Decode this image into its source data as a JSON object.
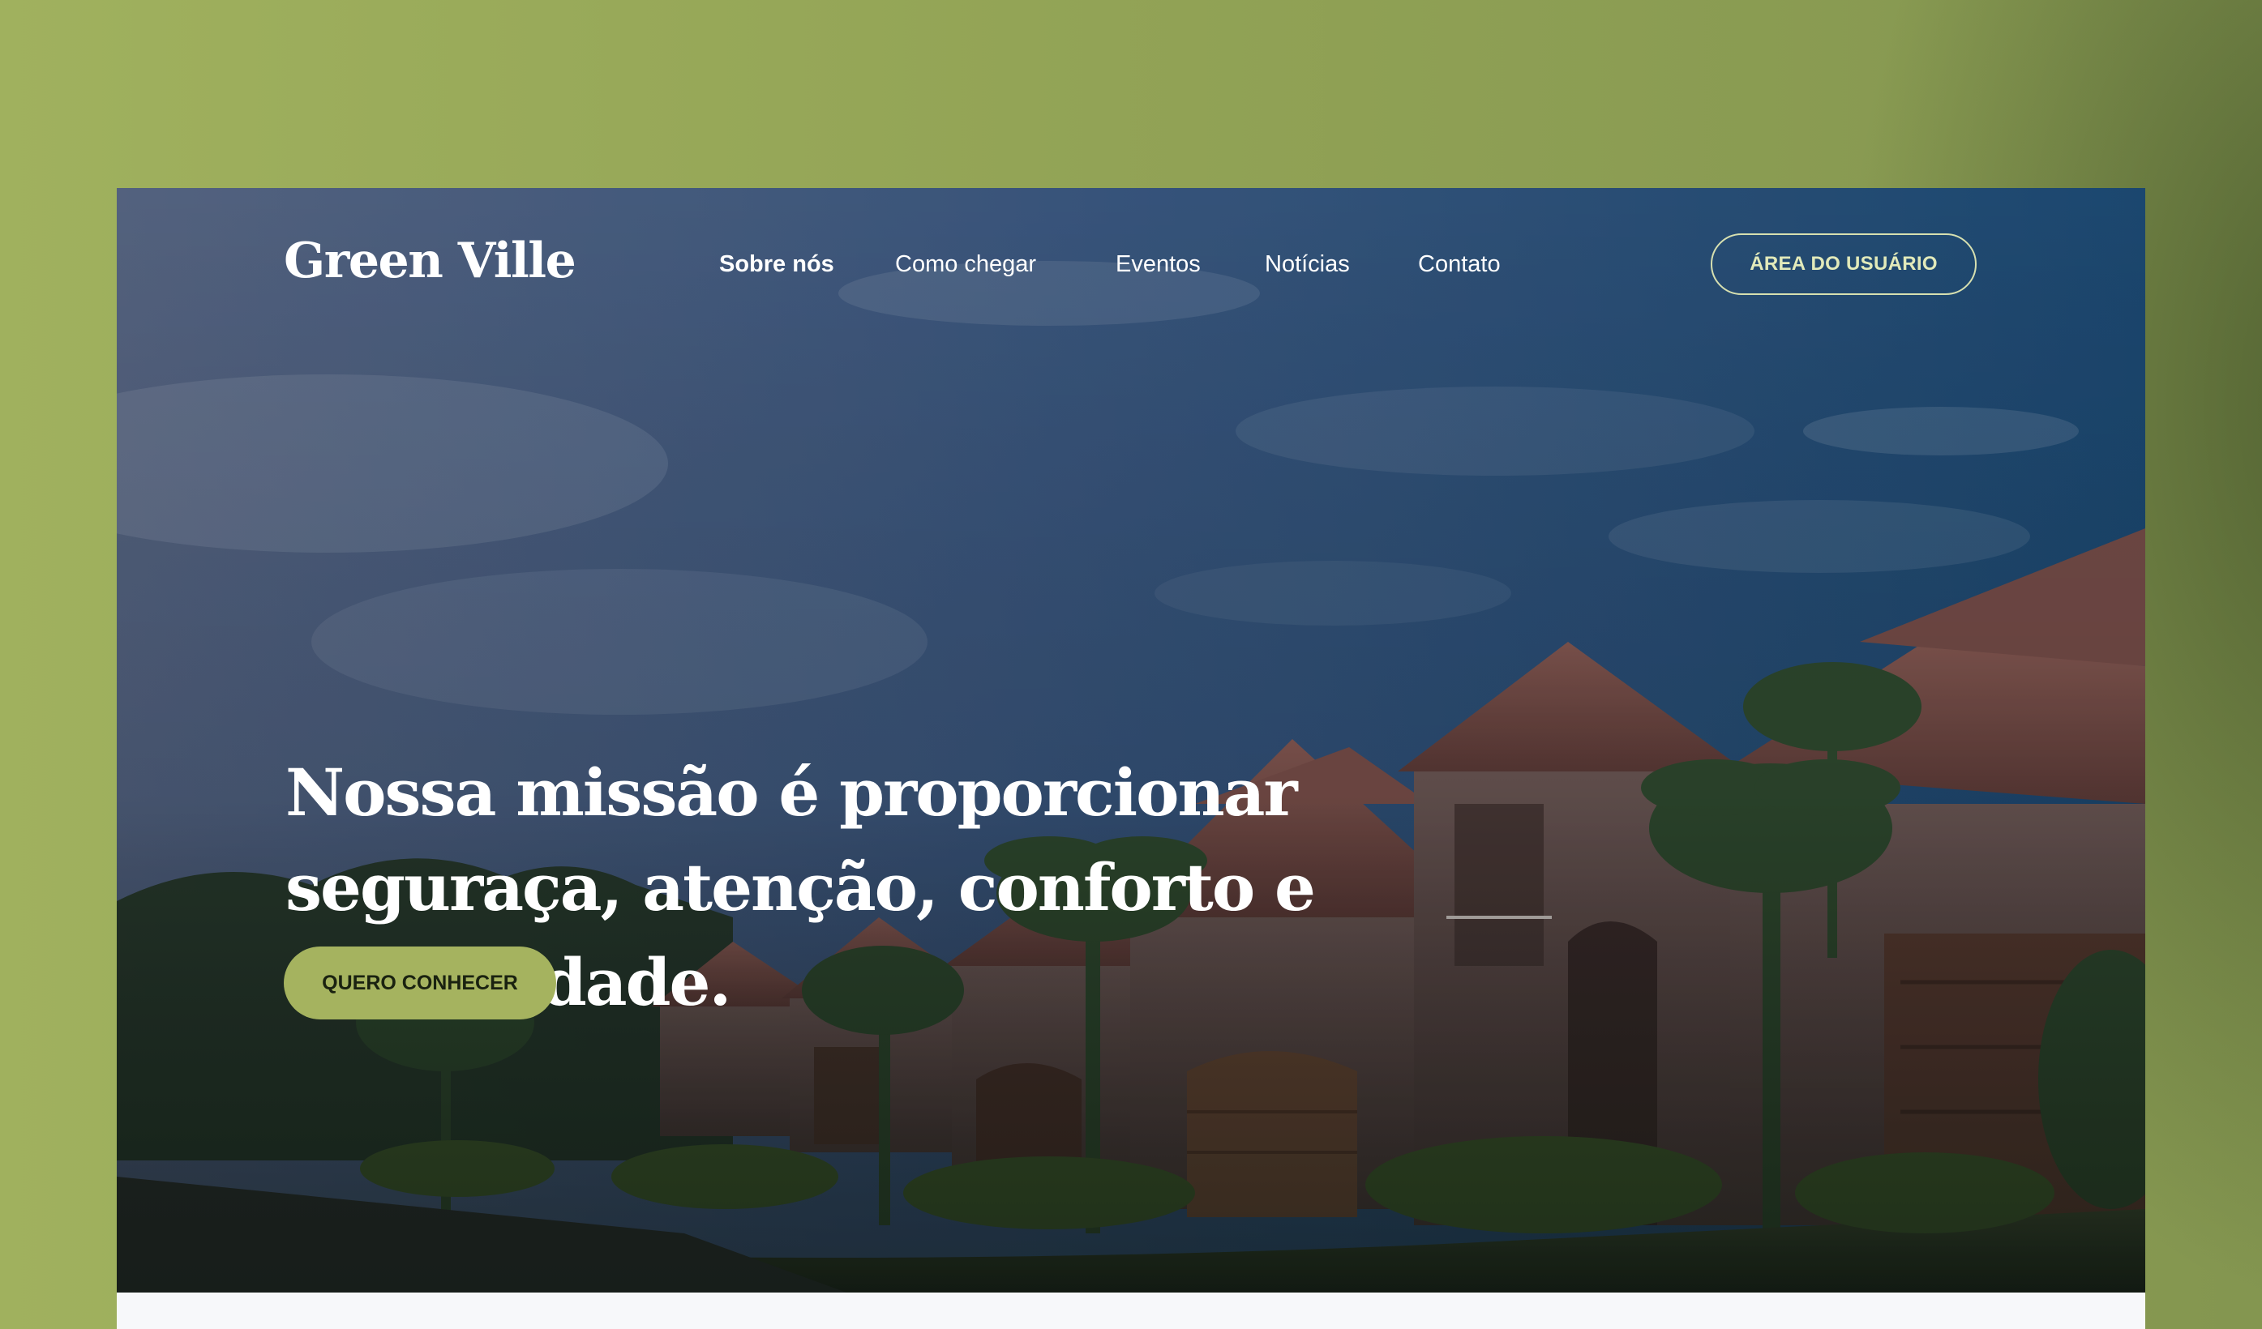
{
  "brand": {
    "name": "Green Ville"
  },
  "nav": {
    "items": [
      {
        "label": "Sobre nós",
        "active": true
      },
      {
        "label": "Como chegar",
        "active": false
      },
      {
        "label": "Eventos",
        "active": false
      },
      {
        "label": "Notícias",
        "active": false
      },
      {
        "label": "Contato",
        "active": false
      }
    ],
    "user_area_label": "ÁREA DO USUÁRIO"
  },
  "hero": {
    "headline_lines": [
      "Nossa missão é proporcionar",
      "seguraça, atenção, conforto e",
      "estabilidade."
    ],
    "cta_label": "QUERO CONHECER"
  },
  "colors": {
    "page_background": "#93a456",
    "accent": "#a5b35f",
    "cta_text": "#1a2210",
    "sky_overlay": "#2c4e72"
  }
}
